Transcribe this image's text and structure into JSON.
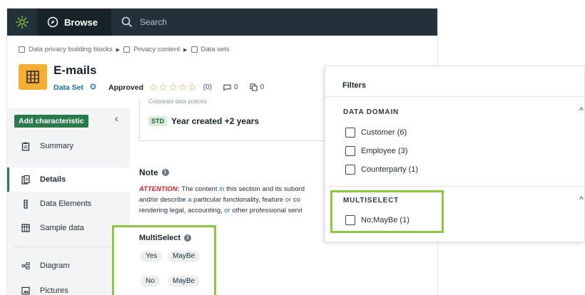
{
  "topbar": {
    "browse_label": "Browse",
    "search_placeholder": "Search"
  },
  "breadcrumb": [
    "Data privacy building blocks",
    "Privacy content",
    "Data sets"
  ],
  "asset": {
    "title": "E-mails",
    "type": "Data Set",
    "status": "Approved",
    "rating_count": "(0)",
    "comments": "0",
    "relations": "0"
  },
  "sidebar": {
    "add_label": "Add characteristic",
    "items": [
      {
        "label": "Summary",
        "icon": "clipboard-icon"
      },
      {
        "label": "Details",
        "icon": "document-icon",
        "active": true
      },
      {
        "label": "Data Elements",
        "icon": "column-icon"
      },
      {
        "label": "Sample data",
        "icon": "table-icon"
      },
      {
        "label": "Diagram",
        "icon": "diagram-icon"
      },
      {
        "label": "Pictures",
        "icon": "picture-icon"
      }
    ]
  },
  "characteristic": {
    "cut_text": "Corporate data policies",
    "badge": "STD",
    "value": "Year created +2 years"
  },
  "note": {
    "title": "Note",
    "line1_attn": "ATTENTION:",
    "line1_a": " The content ",
    "line1_in": "in",
    "line1_b": " this section and its subord",
    "line2_a": "and/or describe ",
    "line2_particular": "a",
    "line2_b": " particular functionality, feature ",
    "line2_or": "or",
    "line2_c": " co",
    "line3_a": "rendering legal, accounting, ",
    "line3_or": "or",
    "line3_b": " other professional servi"
  },
  "multiselect": {
    "title": "MultiSelect",
    "row1": [
      "Yes",
      "MayBe"
    ],
    "row2": [
      "No",
      "MayBe"
    ]
  },
  "filters": {
    "title": "Filters",
    "data_domain_heading": "DATA DOMAIN",
    "data_domain_options": [
      "Customer (6)",
      "Employee (3)",
      "Counterparty (1)"
    ],
    "multiselect_heading": "MULTISELECT",
    "multiselect_options": [
      "No;MayBe (1)"
    ]
  },
  "colors": {
    "accent_green": "#2b7a4b",
    "highlight": "#8dc63f",
    "topbar": "#23313a",
    "tile": "#f5ae34"
  }
}
